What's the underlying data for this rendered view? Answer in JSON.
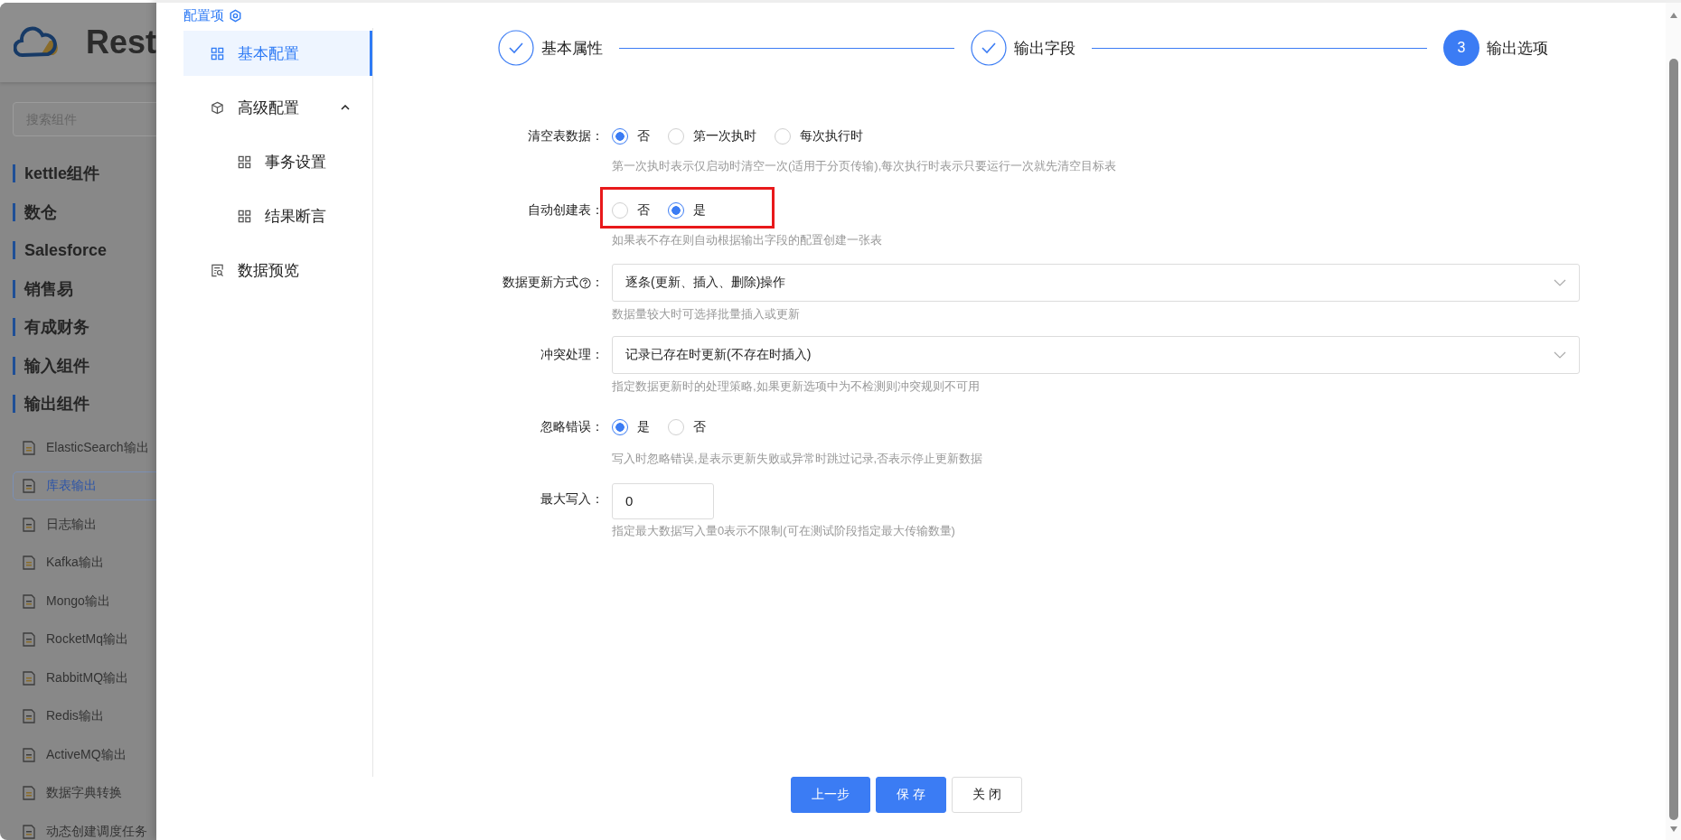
{
  "background_app": {
    "logo_text": "Rest",
    "search": {
      "placeholder": "搜索组件"
    },
    "groups": [
      {
        "label": "kettle组件"
      },
      {
        "label": "数仓"
      },
      {
        "label": "Salesforce"
      },
      {
        "label": "销售易"
      },
      {
        "label": "有成财务"
      },
      {
        "label": "输入组件"
      },
      {
        "label": "输出组件"
      }
    ],
    "items": [
      {
        "label": "ElasticSearch输出",
        "selected": false
      },
      {
        "label": "库表输出",
        "selected": true
      },
      {
        "label": "日志输出",
        "selected": false
      },
      {
        "label": "Kafka输出",
        "selected": false
      },
      {
        "label": "Mongo输出",
        "selected": false
      },
      {
        "label": "RocketMq输出",
        "selected": false
      },
      {
        "label": "RabbitMQ输出",
        "selected": false
      },
      {
        "label": "Redis输出",
        "selected": false
      },
      {
        "label": "ActiveMQ输出",
        "selected": false
      },
      {
        "label": "数据字典转换",
        "selected": false
      },
      {
        "label": "动态创建调度任务",
        "selected": false
      }
    ]
  },
  "drawer": {
    "title": "配置项",
    "nav": [
      {
        "label": "基本配置",
        "selected": true
      },
      {
        "label": "高级配置",
        "selected": false,
        "expanded": true,
        "children": [
          {
            "label": "事务设置",
            "selected": false
          },
          {
            "label": "结果断言",
            "selected": false
          }
        ]
      },
      {
        "label": "数据预览",
        "selected": false
      }
    ],
    "steps": [
      {
        "label": "基本属性",
        "completed": true
      },
      {
        "label": "输出字段",
        "completed": true
      },
      {
        "label": "输出选项",
        "completed": false,
        "number": "3"
      }
    ],
    "form": [
      {
        "kind": "radio",
        "label": "清空表数据",
        "colon": "：",
        "options": [
          {
            "label": "否",
            "selected": true
          },
          {
            "label": "第一次执时",
            "selected": false
          },
          {
            "label": "每次执行时",
            "selected": false
          }
        ],
        "hint": "第一次执时表示仅启动时清空一次(适用于分页传输),每次执行时表示只要运行一次就先清空目标表"
      },
      {
        "kind": "radio",
        "label": "自动创建表",
        "colon": "：",
        "highlighted": true,
        "options": [
          {
            "label": "否",
            "selected": false
          },
          {
            "label": "是",
            "selected": true
          }
        ],
        "hint": "如果表不存在则自动根据输出字段的配置创建一张表"
      },
      {
        "kind": "select",
        "label": "数据更新方式",
        "help_icon": true,
        "colon": "：",
        "value": "逐条(更新、插入、删除)操作",
        "hint": "数据量较大时可选择批量插入或更新"
      },
      {
        "kind": "select",
        "label": "冲突处理",
        "colon": "：",
        "value": "记录已存在时更新(不存在时插入)",
        "hint": "指定数据更新时的处理策略,如果更新选项中为不检测则冲突规则不可用"
      },
      {
        "kind": "radio",
        "label": "忽略错误",
        "colon": "：",
        "options": [
          {
            "label": "是",
            "selected": true
          },
          {
            "label": "否",
            "selected": false
          }
        ],
        "hint": "写入时忽略错误,是表示更新失败或异常时跳过记录,否表示停止更新数据"
      },
      {
        "kind": "input",
        "label": "最大写入",
        "colon": "：",
        "value": "0",
        "hint": "指定最大数据写入量0表示不限制(可在测试阶段指定最大传输数量)"
      }
    ],
    "buttons": [
      {
        "label": "上一步",
        "kind": "primary"
      },
      {
        "label": "保 存",
        "kind": "primary"
      },
      {
        "label": "关 闭",
        "kind": "default"
      }
    ]
  }
}
